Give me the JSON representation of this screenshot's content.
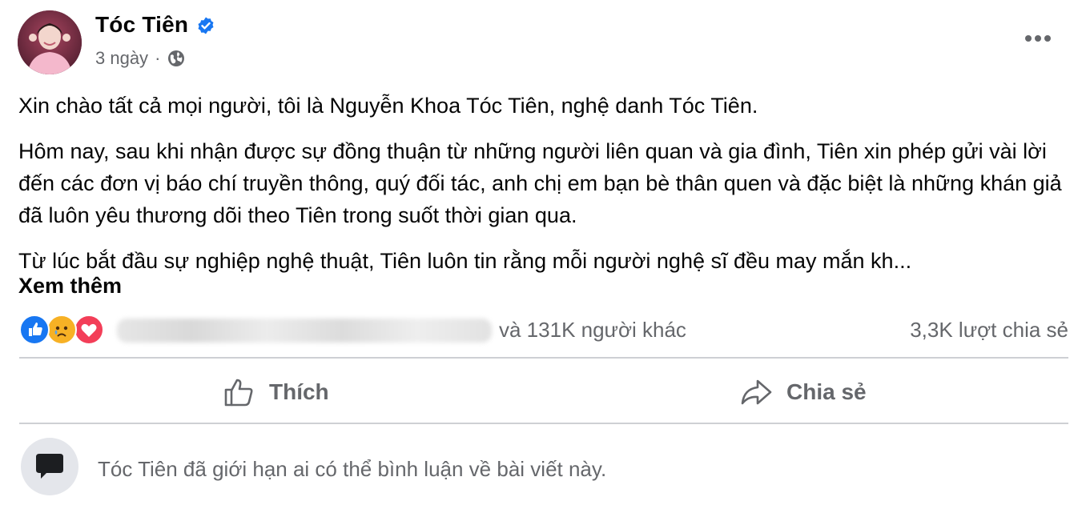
{
  "post": {
    "author": "Tóc Tiên",
    "time": "3 ngày",
    "separator": "·",
    "paragraphs": [
      "Xin chào tất cả mọi người, tôi là Nguyễn Khoa Tóc Tiên, nghệ danh Tóc Tiên.",
      "Hôm nay, sau khi nhận được sự đồng thuận từ những người liên quan và gia đình, Tiên xin phép gửi vài lời đến các đơn vị báo chí truyền thông, quý đối tác, anh chị em bạn bè thân quen và đặc biệt là những khán giả đã luôn yêu thương dõi theo Tiên trong suốt thời gian qua.",
      "Từ lúc bắt đầu sự nghiệp nghệ thuật, Tiên luôn tin rằng mỗi người nghệ sĩ đều may mắn kh..."
    ],
    "see_more": "Xem thêm",
    "reactions_text": "và 131K người khác",
    "shares_text": "3,3K lượt chia sẻ",
    "reaction_icons": [
      "like-icon",
      "sad-icon",
      "love-icon"
    ]
  },
  "actions": {
    "like_label": "Thích",
    "share_label": "Chia sẻ"
  },
  "comments": {
    "restricted_note": "Tóc Tiên đã giới hạn ai có thể bình luận về bài viết này."
  },
  "colors": {
    "accent": "#1877f2",
    "muted": "#65676b",
    "love": "#f33e58",
    "sad": "#f7b125"
  }
}
